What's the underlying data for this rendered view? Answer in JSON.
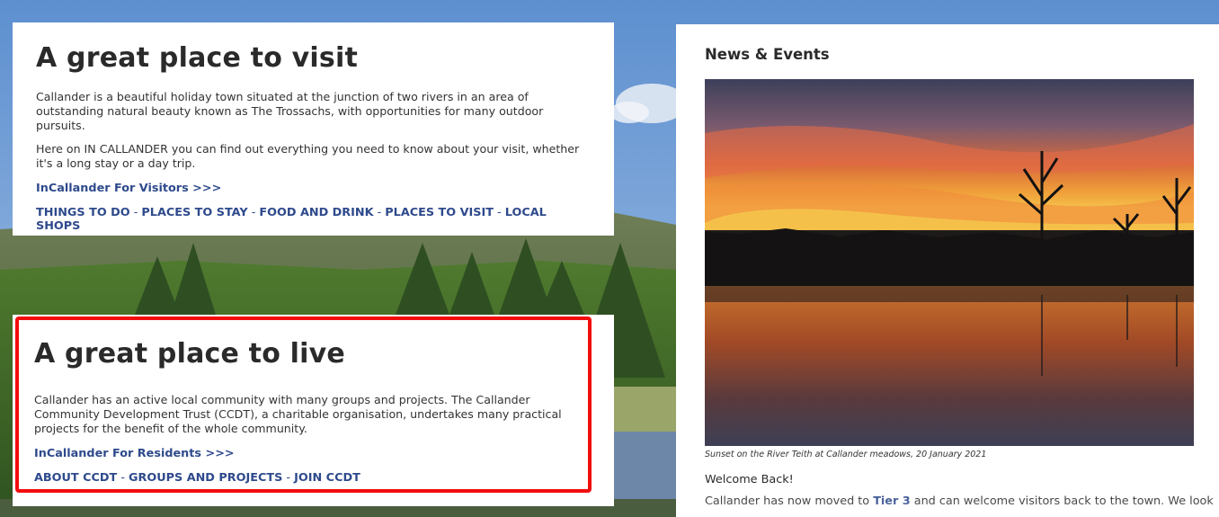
{
  "visit": {
    "title": "A great place to visit",
    "intro": "Callander is a beautiful holiday town situated at the junction of two rivers in an area of outstanding natural beauty known as The Trossachs, with opportunities for many outdoor pursuits.",
    "detail": "Here on IN CALLANDER you can find out everything you need to know about your visit, whether it's a long stay or a day trip.",
    "more_link": "InCallander For Visitors >>>",
    "links": [
      "THINGS TO DO",
      "PLACES TO STAY",
      "FOOD AND DRINK",
      "PLACES TO VISIT",
      "LOCAL SHOPS"
    ],
    "separator": " - "
  },
  "live": {
    "title": "A great place to live",
    "intro": "Callander has an active local community with many groups and projects. The Callander Community Development Trust (CCDT), a charitable organisation, undertakes many practical projects for the benefit of the whole community.",
    "more_link": "InCallander For Residents >>>",
    "links": [
      "ABOUT CCDT",
      "GROUPS AND PROJECTS",
      "JOIN CCDT"
    ],
    "separator": " - "
  },
  "news": {
    "heading": "News & Events",
    "caption": "Sunset on the River Teith at Callander meadows, 20 January 2021",
    "welcome": "Welcome Back!",
    "body_prefix": "Callander has now moved to ",
    "body_link": "Tier 3",
    "body_suffix": " and can welcome visitors back to the town. We look"
  },
  "colors": {
    "link": "#2e4a8c",
    "highlight": "#f20d0d"
  }
}
